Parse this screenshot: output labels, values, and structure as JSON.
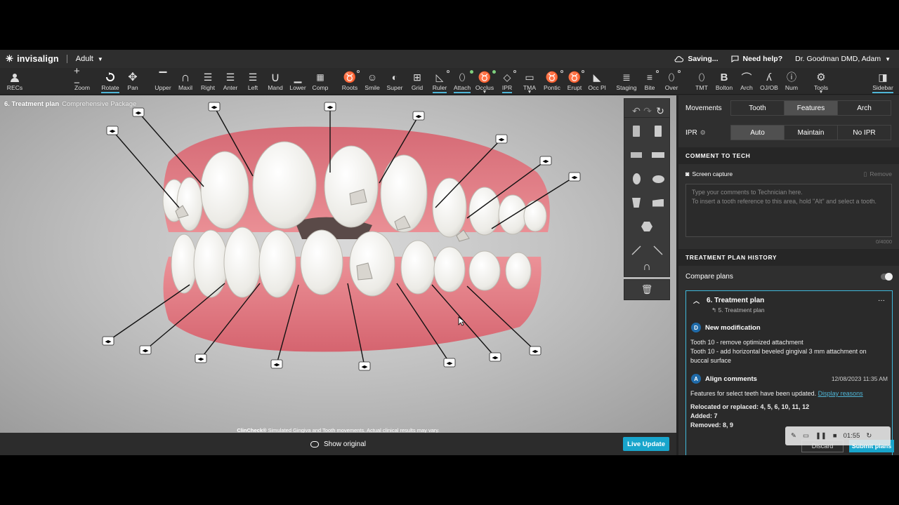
{
  "header": {
    "brand": "invisalign",
    "mode": "Adult",
    "saving": "Saving...",
    "help": "Need help?",
    "user": "Dr. Goodman DMD, Adam"
  },
  "toolbar": {
    "recs": "RECs",
    "zoom": "Zoom",
    "rotate": "Rotate",
    "pan": "Pan",
    "upper": "Upper",
    "maxil": "Maxil",
    "right": "Right",
    "anter": "Anter",
    "left": "Left",
    "mand": "Mand",
    "lower": "Lower",
    "comp": "Comp",
    "roots": "Roots",
    "smile": "Smile",
    "super": "Super",
    "grid": "Grid",
    "ruler": "Ruler",
    "attach": "Attach",
    "occlus": "Occlus",
    "ipr": "IPR",
    "tma": "TMA",
    "pontic": "Pontic",
    "erupt": "Erupt",
    "occpl": "Occ Pl",
    "staging": "Staging",
    "bite": "Bite",
    "over": "Over",
    "tmt": "TMT",
    "bolton": "Bolton",
    "arch": "Arch",
    "ojob": "OJ/OB",
    "num": "Num",
    "tools": "Tools",
    "sidebar": "Sidebar"
  },
  "viewport": {
    "title": "6. Treatment plan",
    "package": "Comprehensive Package",
    "disclaimer_brand": "ClinCheck®",
    "disclaimer_text": "Simulated Gingiva and Tooth movements. Actual clinical results may vary."
  },
  "bottom": {
    "show_original": "Show original",
    "live_update": "Live Update"
  },
  "sidebar": {
    "movements_label": "Movements",
    "movements_options": [
      "Tooth",
      "Features",
      "Arch"
    ],
    "movements_selected": "Features",
    "ipr_label": "IPR",
    "ipr_options": [
      "Auto",
      "Maintain",
      "No IPR"
    ],
    "ipr_selected": "Auto",
    "comment_header": "COMMENT TO TECH",
    "screen_capture": "Screen capture",
    "remove": "Remove",
    "comment_placeholder_1": "Type your comments to Technician here.",
    "comment_placeholder_2": "To insert a tooth reference to this area, hold \"Alt\" and select a tooth.",
    "char_count": "0/4000",
    "history_header": "TREATMENT PLAN HISTORY",
    "compare_plans": "Compare plans",
    "plan_title": "6. Treatment plan",
    "plan_parent": "5. Treatment plan",
    "mod_badge": "D",
    "mod_title": "New modification",
    "mod_line1": "Tooth 10 - remove optimized attachment",
    "mod_line2": "Tooth 10 - add horizontal beveled gingival 3 mm attachment on buccal surface",
    "align_badge": "A",
    "align_title": "Align comments",
    "align_date": "12/08/2023 11:35 AM",
    "align_text": "Features for select teeth have been updated.",
    "display_reasons": "Display reasons",
    "relocated": "Relocated or replaced: 4, 5, 6, 10, 11, 12",
    "added": "Added: 7",
    "removed": "Removed: 8, 9",
    "discard": "Discard",
    "submit": "Submit plans"
  },
  "recorder": {
    "time": "01:55"
  },
  "colors": {
    "accent": "#18a5cc",
    "gum": "#e37f86",
    "panel": "#2f2f2f"
  }
}
